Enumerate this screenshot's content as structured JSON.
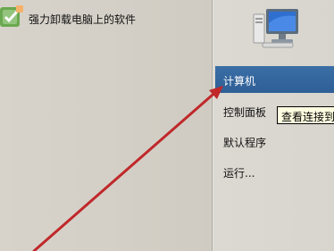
{
  "start_menu": {
    "pinned_programs": [
      {
        "label": "强力卸载电脑上的软件",
        "icon": "uninstall-icon"
      }
    ],
    "user_icon": "computer-icon",
    "right_items": [
      {
        "label": "计算机",
        "selected": true
      },
      {
        "label": "控制面板",
        "selected": false
      },
      {
        "label": "默认程序",
        "selected": false
      },
      {
        "label": "运行...",
        "selected": false
      }
    ],
    "tooltip": "查看连接到"
  },
  "colors": {
    "menu_background": "#d4d0c8",
    "selection": "#3a6ea5",
    "tooltip_background": "#ffffe1",
    "annotation_arrow": "#c0282a"
  }
}
